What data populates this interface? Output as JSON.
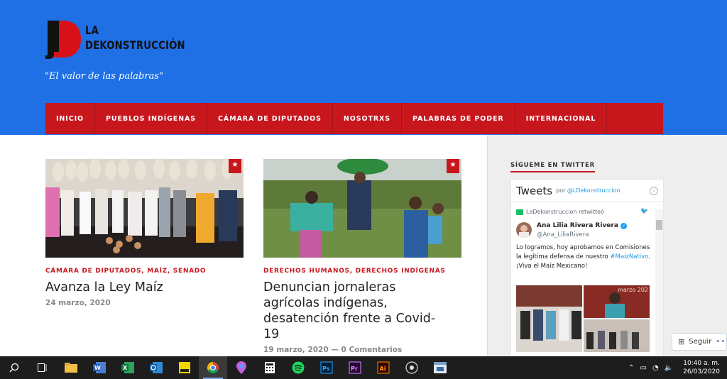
{
  "header": {
    "logo_line1": "LA",
    "logo_line2": "DEKONSTRUCCIÓN",
    "tagline": "\"El valor de las palabras\""
  },
  "nav": {
    "items": [
      {
        "label": "INICIO"
      },
      {
        "label": "PUEBLOS INDÍGENAS"
      },
      {
        "label": "CÁMARA DE DIPUTADOS"
      },
      {
        "label": "NOSOTRXS"
      },
      {
        "label": "PALABRAS DE PODER"
      },
      {
        "label": "INTERNACIONAL"
      }
    ]
  },
  "posts": [
    {
      "categories": "CÁMARA DE DIPUTADOS, MAÍZ, SENADO",
      "title": "Avanza la Ley Maíz",
      "date": "24 marzo, 2020",
      "comments": ""
    },
    {
      "categories": "DERECHOS HUMANOS, DERECHOS INDÍGENAS",
      "title": "Denuncian jornaleras agrícolas indígenas, desatención frente a Covid-19",
      "date": "19 marzo, 2020",
      "comments": "0 Comentarios"
    }
  ],
  "sidebar": {
    "title": "SÍGUEME EN TWITTER",
    "widget": {
      "heading": "Tweets",
      "by_label": "por",
      "by_handle": "@LDekonstruccion",
      "retweet_label": "LaDekonstruccion retwitteó",
      "author_name": "Ana Lilia Rivera Rivera",
      "author_handle": "@Ana_LiliaRivera",
      "text_before": "Lo logramos, hoy aprobamos en Comisiones la legítima defensa de nuestro ",
      "hashtag": "#MaízNativo",
      "text_after": ". ¡Viva el Maíz Mexicano!",
      "media_caption": "marzo 202"
    },
    "follow_label": "Seguir"
  },
  "taskbar": {
    "time": "10:40 a. m.",
    "date": "26/03/2020"
  },
  "colors": {
    "header_bg": "#1f6fe5",
    "accent": "#c8161d",
    "taskbar": "#1d1d1d"
  }
}
